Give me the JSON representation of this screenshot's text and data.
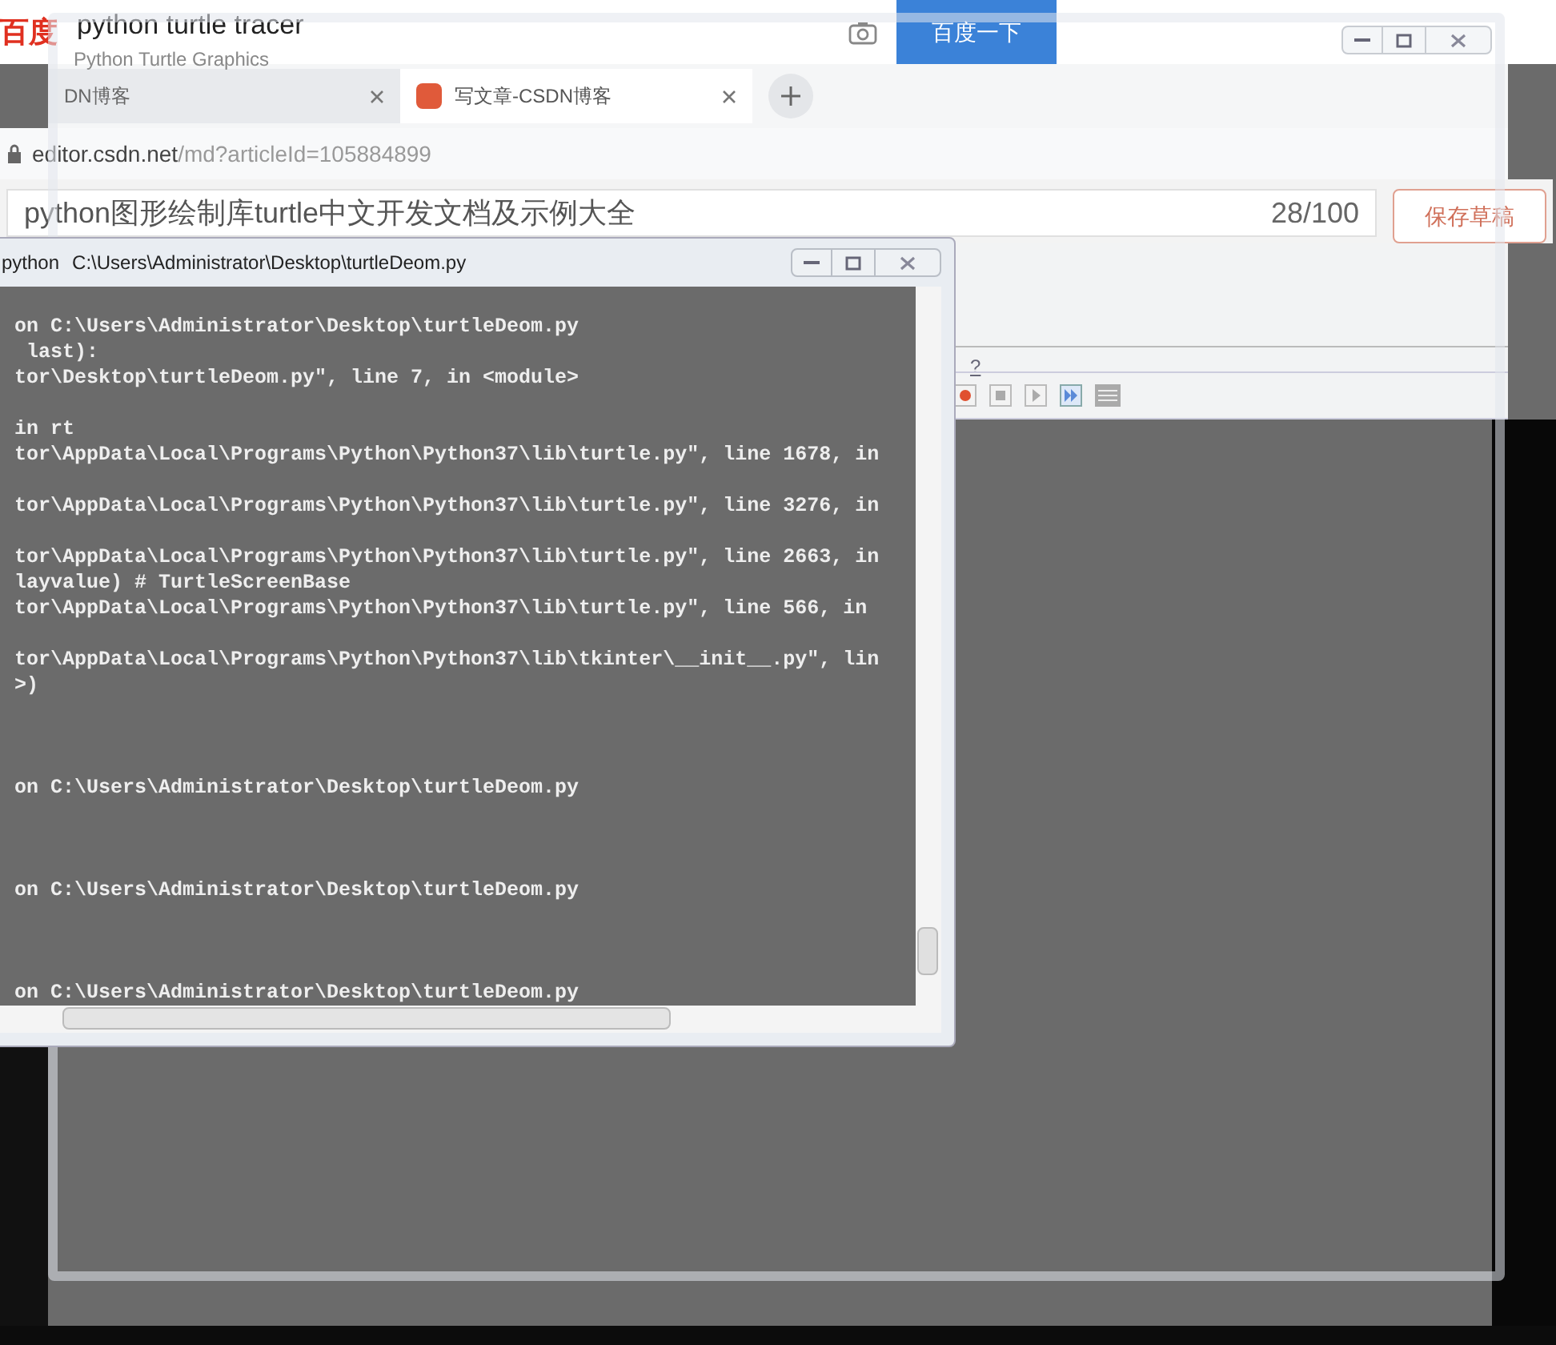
{
  "search_bar": {
    "logo": "百度",
    "query": "python turtle tracer",
    "button": "百度一下"
  },
  "turtle_window": {
    "title": "Python Turtle Graphics",
    "help": "?"
  },
  "browser": {
    "tabs": [
      {
        "label": "DN博客",
        "selected": false
      },
      {
        "label": "写文章-CSDN博客",
        "selected": true
      }
    ],
    "address": {
      "host": "editor.csdn.net",
      "path": "/md?articleId=105884899"
    },
    "editor": {
      "title": "python图形绘制库turtle中文开发文档及示例大全",
      "counter": "28/100",
      "save_button": "保存草稿"
    }
  },
  "console": {
    "title_app": "python",
    "title_path": "C:\\Users\\Administrator\\Desktop\\turtleDeom.py",
    "blocks": [
      {
        "kind": "trace",
        "lines": [
          "on C:\\Users\\Administrator\\Desktop\\turtleDeom.py",
          " last):",
          "tor\\Desktop\\turtleDeom.py\", line 7, in <module>"
        ]
      },
      {
        "kind": "trace",
        "lines": [
          "in rt",
          "tor\\AppData\\Local\\Programs\\Python\\Python37\\lib\\turtle.py\", line 1678, in"
        ]
      },
      {
        "kind": "trace",
        "lines": [
          "tor\\AppData\\Local\\Programs\\Python\\Python37\\lib\\turtle.py\", line 3276, in"
        ]
      },
      {
        "kind": "trace",
        "lines": [
          "tor\\AppData\\Local\\Programs\\Python\\Python37\\lib\\turtle.py\", line 2663, in",
          "layvalue) # TurtleScreenBase",
          "tor\\AppData\\Local\\Programs\\Python\\Python37\\lib\\turtle.py\", line 566, in"
        ]
      },
      {
        "kind": "trace",
        "lines": [
          "tor\\AppData\\Local\\Programs\\Python\\Python37\\lib\\tkinter\\__init__.py\", lin",
          ">)"
        ]
      },
      {
        "kind": "prompt",
        "lines": [
          "on C:\\Users\\Administrator\\Desktop\\turtleDeom.py"
        ]
      },
      {
        "kind": "prompt",
        "lines": [
          "on C:\\Users\\Administrator\\Desktop\\turtleDeom.py"
        ]
      },
      {
        "kind": "prompt",
        "lines": [
          "on C:\\Users\\Administrator\\Desktop\\turtleDeom.py"
        ]
      }
    ]
  }
}
